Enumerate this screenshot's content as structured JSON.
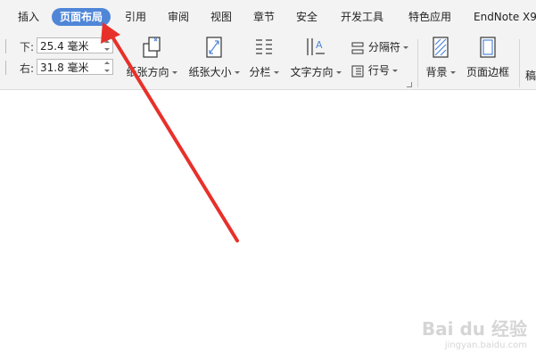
{
  "tabs": [
    {
      "label": "插入"
    },
    {
      "label": "页面布局"
    },
    {
      "label": "引用"
    },
    {
      "label": "审阅"
    },
    {
      "label": "视图"
    },
    {
      "label": "章节"
    },
    {
      "label": "安全"
    },
    {
      "label": "开发工具"
    },
    {
      "label": "特色应用"
    },
    {
      "label": "EndNote X9"
    }
  ],
  "active_tab": "页面布局",
  "margins": {
    "bottom": {
      "label": "下:",
      "value": "25.4 毫米"
    },
    "right": {
      "label": "右:",
      "value": "31.8 毫米"
    }
  },
  "ribbon": {
    "orientation": "纸张方向",
    "paper_size": "纸张大小",
    "columns": "分栏",
    "text_direction": "文字方向",
    "separator": "分隔符",
    "line_numbers": "行号",
    "background": "背景",
    "page_border": "页面边框",
    "cut_off": "稿"
  },
  "watermark": {
    "brand": "Bai du 经验",
    "url": "jingyan.baidu.com"
  },
  "colors": {
    "accent": "#4f86d8",
    "arrow": "#e8302a"
  }
}
